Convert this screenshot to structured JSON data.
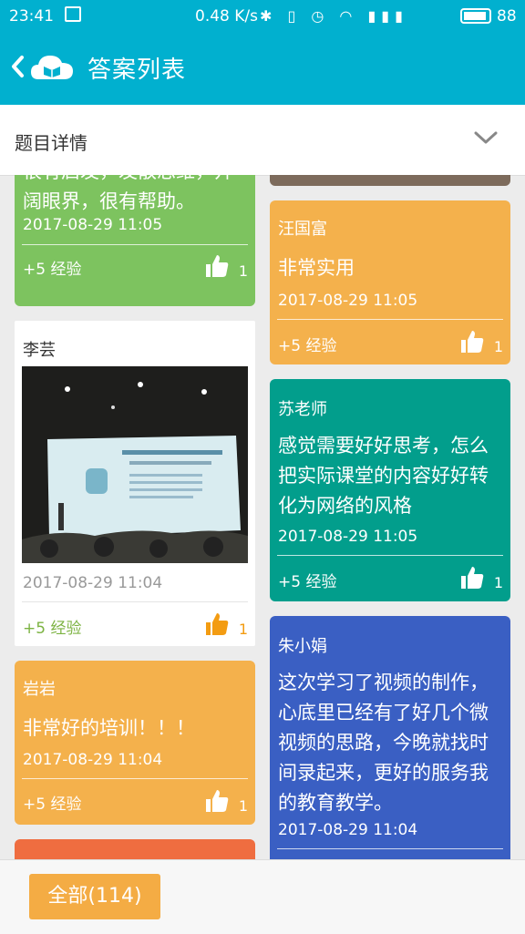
{
  "status": {
    "time": "23:41",
    "speed": "0.48 K/s",
    "icons": "✱ ▯ ◷ ◠ ▮▮▮",
    "battery": "88"
  },
  "header": {
    "title": "答案列表"
  },
  "detail": {
    "label": "题目详情"
  },
  "colors": {
    "green": "#7dc35f",
    "orange": "#f4b14c",
    "teal": "#029e8c",
    "blue": "#3a5fc3",
    "header": "#01b0cf",
    "like_orange": "#f39c12"
  },
  "cards": {
    "c1": {
      "content": "很有启发，发散思维，开阔眼界，很有帮助。",
      "date": "2017-08-29 11:05",
      "exp": "+5 经验",
      "likes": "1"
    },
    "c2": {
      "name": "李芸",
      "date": "2017-08-29 11:04",
      "exp": "+5 经验",
      "likes": "1",
      "image": "conference-photo"
    },
    "c3": {
      "name": "岩岩",
      "content": "非常好的培训！！！",
      "date": "2017-08-29 11:04",
      "exp": "+5 经验",
      "likes": "1"
    },
    "c5": {
      "name": "汪国富",
      "content": "非常实用",
      "date": "2017-08-29 11:05",
      "exp": "+5 经验",
      "likes": "1"
    },
    "c6": {
      "name": "苏老师",
      "content": "感觉需要好好思考，怎么把实际课堂的内容好好转化为网络的风格",
      "date": "2017-08-29 11:05",
      "exp": "+5 经验",
      "likes": "1"
    },
    "c7": {
      "name": "朱小娟",
      "content": "这次学习了视频的制作，心底里已经有了好几个微视频的思路，今晚就找时间录起来，更好的服务我的教育教学。",
      "date": "2017-08-29 11:04"
    }
  },
  "bottom": {
    "all_label": "全部(114)"
  }
}
